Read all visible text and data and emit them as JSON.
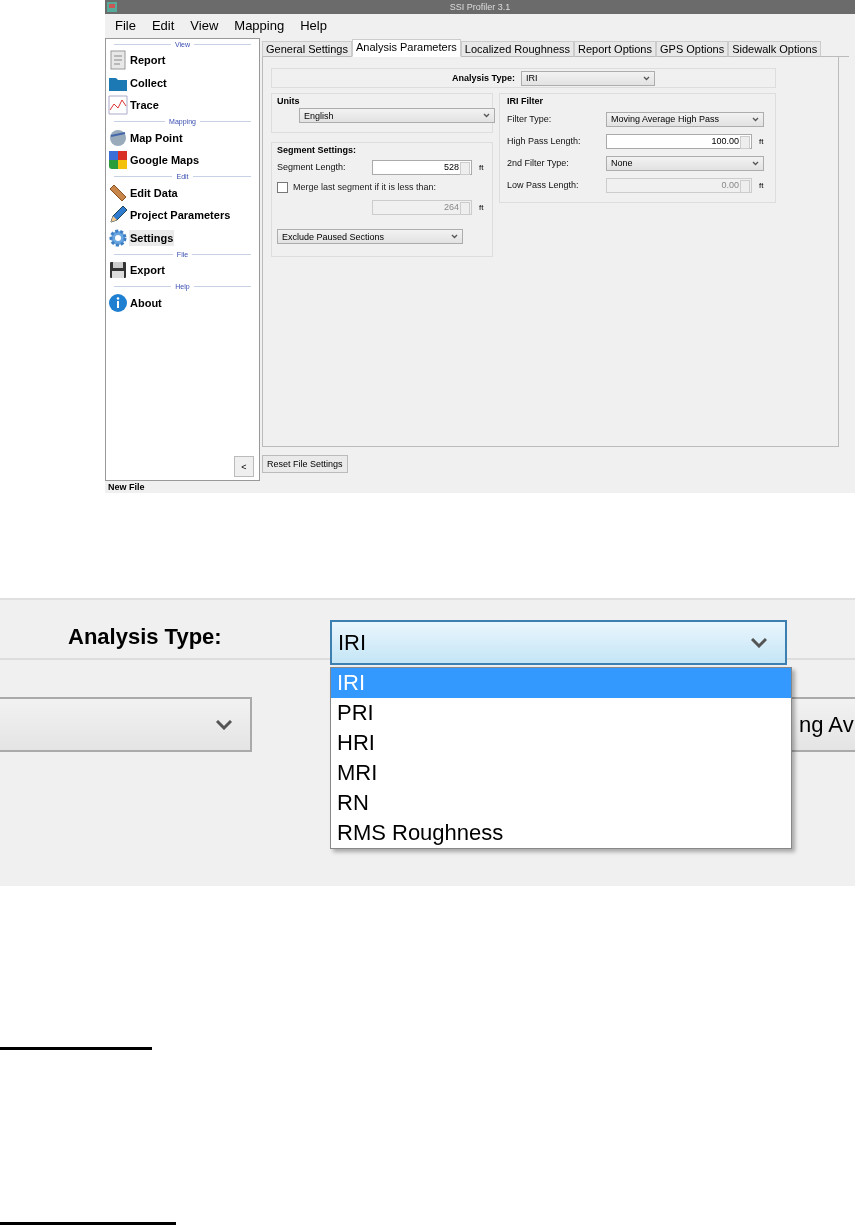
{
  "window": {
    "title": "SSI Profiler 3.1"
  },
  "menu": [
    "File",
    "Edit",
    "View",
    "Mapping",
    "Help"
  ],
  "sidebar": {
    "sections": [
      {
        "header": "View",
        "items": [
          {
            "label": "Report",
            "selected": false
          },
          {
            "label": "Collect",
            "selected": false
          },
          {
            "label": "Trace",
            "selected": false
          }
        ]
      },
      {
        "header": "Mapping",
        "items": [
          {
            "label": "Map Point",
            "selected": false
          },
          {
            "label": "Google Maps",
            "selected": false
          }
        ]
      },
      {
        "header": "Edit",
        "items": [
          {
            "label": "Edit Data",
            "selected": false
          },
          {
            "label": "Project Parameters",
            "selected": false
          },
          {
            "label": "Settings",
            "selected": true
          }
        ]
      },
      {
        "header": "File",
        "items": [
          {
            "label": "Export",
            "selected": false
          }
        ]
      },
      {
        "header": "Help",
        "items": [
          {
            "label": "About",
            "selected": false
          }
        ]
      }
    ],
    "collapse_button": "<"
  },
  "tabs": [
    {
      "label": "General Settings",
      "selected": false
    },
    {
      "label": "Analysis Parameters",
      "selected": true
    },
    {
      "label": "Localized Roughness",
      "selected": false
    },
    {
      "label": "Report Options",
      "selected": false
    },
    {
      "label": "GPS Options",
      "selected": false
    },
    {
      "label": "Sidewalk Options",
      "selected": false
    }
  ],
  "analysis_type": {
    "label": "Analysis Type:",
    "value": "IRI"
  },
  "units": {
    "title": "Units",
    "value": "English"
  },
  "segment_settings": {
    "title": "Segment Settings:",
    "segment_length": {
      "label": "Segment Length:",
      "value": "528",
      "unit": "ft",
      "disabled": false
    },
    "merge": {
      "label": "Merge last segment if it is less than:",
      "checked": false
    },
    "merge_length": {
      "value": "264",
      "unit": "ft",
      "disabled": true
    },
    "paused": {
      "value": "Exclude Paused Sections"
    }
  },
  "iri_filter": {
    "title": "IRI Filter",
    "rows": [
      {
        "kind": "select",
        "label": "Filter Type:",
        "value": "Moving Average High Pass"
      },
      {
        "kind": "spinner",
        "label": "High Pass Length:",
        "value": "100.00",
        "unit": "ft",
        "disabled": false
      },
      {
        "kind": "select",
        "label": "2nd Filter Type:",
        "value": "None"
      },
      {
        "kind": "spinner",
        "label": "Low Pass Length:",
        "value": "0.00",
        "unit": "ft",
        "disabled": true
      }
    ]
  },
  "reset_button": "Reset File Settings",
  "status_bar": "New File",
  "zoomed_view": {
    "label": "Analysis Type:",
    "value": "IRI",
    "options": [
      {
        "label": "IRI",
        "selected": true
      },
      {
        "label": "PRI",
        "selected": false
      },
      {
        "label": "HRI",
        "selected": false
      },
      {
        "label": "MRI",
        "selected": false
      },
      {
        "label": "RN",
        "selected": false
      },
      {
        "label": "RMS Roughness",
        "selected": false
      }
    ],
    "partial_select": "ng Av"
  }
}
